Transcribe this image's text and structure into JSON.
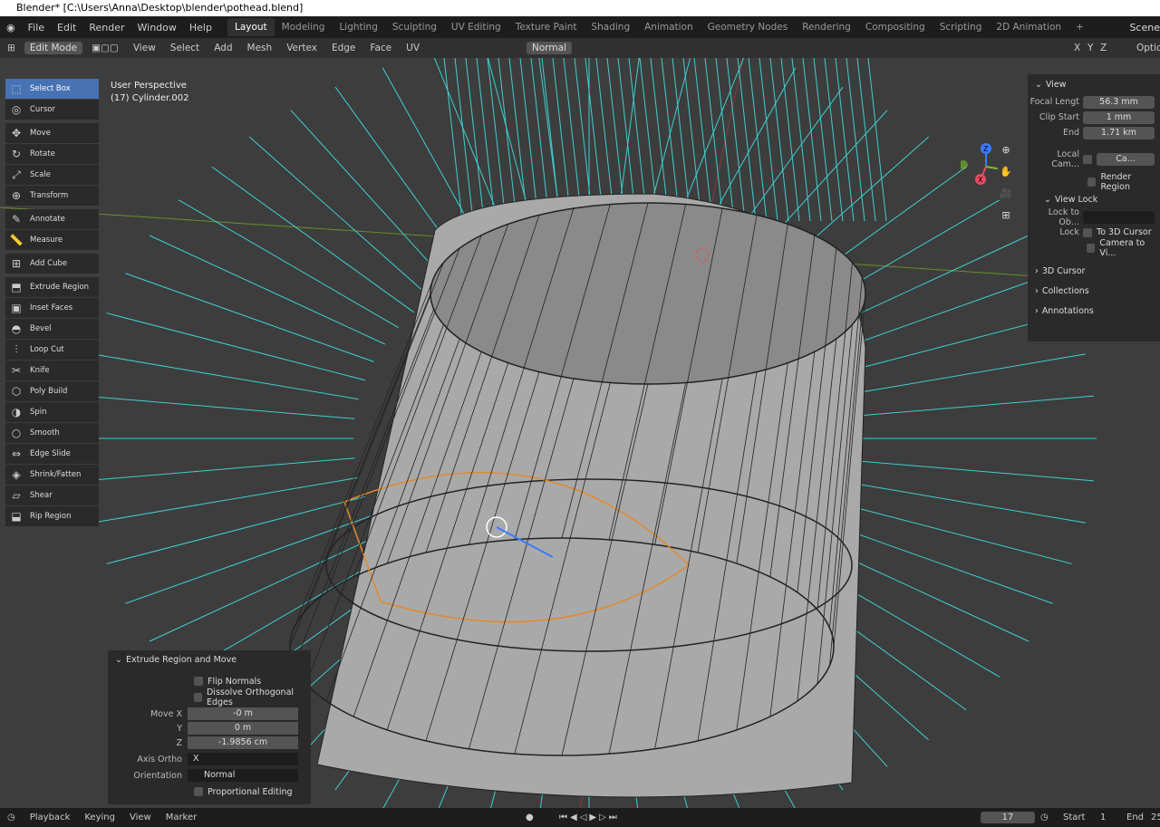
{
  "title": "Blender* [C:\\Users\\Anna\\Desktop\\blender\\pothead.blend]",
  "menu": [
    "File",
    "Edit",
    "Render",
    "Window",
    "Help"
  ],
  "workspaces": [
    "Layout",
    "Modeling",
    "Lighting",
    "Sculpting",
    "UV Editing",
    "Texture Paint",
    "Shading",
    "Animation",
    "Geometry Nodes",
    "Rendering",
    "Compositing",
    "Scripting",
    "2D Animation"
  ],
  "scene": "Scene",
  "header": {
    "mode": "Edit Mode",
    "menus": [
      "View",
      "Select",
      "Add",
      "Mesh",
      "Vertex",
      "Edge",
      "Face",
      "UV"
    ],
    "orientation": "Normal",
    "axes": [
      "X",
      "Y",
      "Z"
    ],
    "options": "Option"
  },
  "viewport": {
    "perspective": "User Perspective",
    "object": "(17) Cylinder.002"
  },
  "tools": [
    "Select Box",
    "Cursor",
    "Move",
    "Rotate",
    "Scale",
    "Transform",
    "Annotate",
    "Measure",
    "Add Cube",
    "Extrude Region",
    "Inset Faces",
    "Bevel",
    "Loop Cut",
    "Knife",
    "Poly Build",
    "Spin",
    "Smooth",
    "Edge Slide",
    "Shrink/Fatten",
    "Shear",
    "Rip Region"
  ],
  "npanel": {
    "view": "View",
    "focal_label": "Focal Lengt",
    "focal": "56.3 mm",
    "clip_start_label": "Clip Start",
    "clip_start": "1 mm",
    "end_label": "End",
    "end": "1.71 km",
    "local_cam": "Local Cam...",
    "local_cam_val": "Ca...",
    "render_region": "Render Region",
    "view_lock": "View Lock",
    "lock_to_obj": "Lock to Ob...",
    "lock": "Lock",
    "to_3d_cursor": "To 3D Cursor",
    "camera_to_view": "Camera to Vi...",
    "cursor3d": "3D Cursor",
    "collections": "Collections",
    "annotations": "Annotations"
  },
  "operator": {
    "title": "Extrude Region and Move",
    "flip": "Flip Normals",
    "dissolve": "Dissolve Orthogonal Edges",
    "move_x_label": "Move X",
    "move_x": "-0 m",
    "y_label": "Y",
    "move_y": "0 m",
    "z_label": "Z",
    "move_z": "-1.9856 cm",
    "axis_ortho_label": "Axis Ortho",
    "axis_ortho": "X",
    "orientation_label": "Orientation",
    "orientation": "Normal",
    "proportional": "Proportional Editing"
  },
  "timeline": {
    "playback": "Playback",
    "keying": "Keying",
    "view": "View",
    "marker": "Marker",
    "frame": "17",
    "start_label": "Start",
    "start": "1",
    "end_label": "End",
    "end": "25"
  }
}
